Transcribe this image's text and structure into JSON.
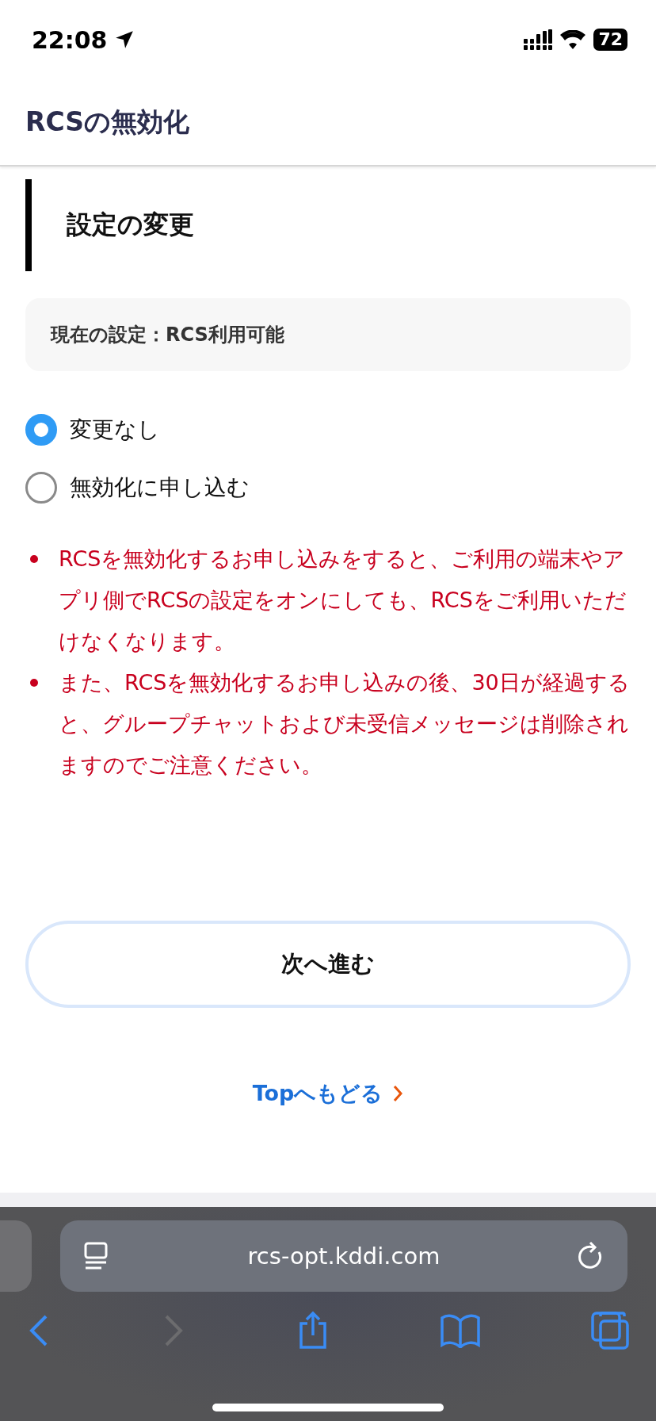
{
  "status_bar": {
    "time": "22:08",
    "battery": "72"
  },
  "header": {
    "title": "RCSの無効化"
  },
  "section": {
    "heading": "設定の変更",
    "current_setting": "現在の設定：RCS利用可能"
  },
  "options": [
    {
      "label": "変更なし",
      "selected": true
    },
    {
      "label": "無効化に申し込む",
      "selected": false
    }
  ],
  "notes": [
    "RCSを無効化するお申し込みをすると、ご利用の端末やアプリ側でRCSの設定をオンにしても、RCSをご利用いただけなくなります。",
    "また、RCSを無効化するお申し込みの後、30日が経過すると、グループチャットおよび未受信メッセージは削除されますのでご注意ください。"
  ],
  "next_button": "次へ進む",
  "top_link": "Topへもどる",
  "browser": {
    "url": "rcs-opt.kddi.com",
    "forward_disabled": true
  }
}
